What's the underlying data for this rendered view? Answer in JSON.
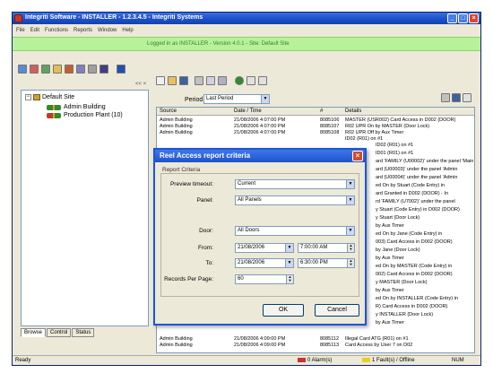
{
  "window": {
    "title": "Integriti Software - INSTALLER - 1.2.3.4.5 - Integriti Systems"
  },
  "menu": [
    "File",
    "Edit",
    "Functions",
    "Reports",
    "Window",
    "Help"
  ],
  "banner": {
    "text": "Logged in as INSTALLER - Version 4.0.1 - Site: Default Site"
  },
  "left_panel": {
    "pane_label": "<< ×",
    "site_name": "Default Site",
    "items": [
      "Admin Building",
      "Production Plant (10)"
    ],
    "tabs": [
      "Browse",
      "Control",
      "Status"
    ]
  },
  "events": {
    "period_label": "Period",
    "period_value": "Last Period",
    "columns": [
      "Source",
      "Date / Time",
      "#",
      "Details"
    ],
    "rows": [
      {
        "source": "Admin Building",
        "datetime": "21/08/2006 4:07:00 PM",
        "num": "8085106",
        "details": "MASTER (USR002) Card Access in D002 (DOOR)"
      },
      {
        "source": "Admin Building",
        "datetime": "21/08/2006 4:07:00 PM",
        "num": "8085107",
        "details": "R02 UPR On by MASTER (Door Lock)"
      },
      {
        "source": "Admin Building",
        "datetime": "21/08/2006 4:07:00 PM",
        "num": "8085108",
        "details": "R02 UPR Off by Aux Timer"
      },
      {
        "source": "",
        "datetime": "",
        "num": "",
        "details": "ID02 (R01) on #1"
      }
    ],
    "details_tail": [
      "ID02 (R01) on #1",
      "ID01 (R01) on #1",
      "ard 'FAMILY (U00002)' under the panel 'Main",
      "ard (U00003)' under the panel 'Admin",
      "ard (U00004)' under the panel 'Admin",
      "ed On by Stuart (Code Entry) in",
      "ard Granted in D002 (DOOR) - In",
      "rd 'FAMILY (U7002)' under the panel",
      "y Stuart (Code Entry) in D002 (DOOR)",
      "y Stuart (Door Lock)",
      "by Aux Timer",
      "ed On by Jane (Code Entry) in",
      "003) Card Access in D002 (DOOR)",
      "by Jane (Door Lock)",
      "by Aux Timer",
      "ed On by MASTER (Code Entry) in",
      "002) Card Access in D002 (DOOR)",
      "y MASTER (Door Lock)",
      "by Aux Timer",
      "ed On by INSTALLER (Code Entry) in",
      "R) Card Access in D002 (DOOR)",
      "y INSTALLER (Door Lock)",
      "by Aux Timer"
    ],
    "bottom_rows": [
      {
        "source": "Admin Building",
        "datetime": "21/08/2006 4:09:00 PM",
        "num": "8085112",
        "details": "Illegal Card ATG (R01) on #1"
      },
      {
        "source": "Admin Building",
        "datetime": "21/08/2006 4:09:00 PM",
        "num": "8085113",
        "details": "Card Access by User 7 on D02"
      }
    ]
  },
  "status_bar": {
    "left": "Ready",
    "alarms": "0 Alarm(s)",
    "faults": "1 Fault(s) / Offline",
    "mode": "NUM"
  },
  "dialog": {
    "title": "Reel Access report criteria",
    "subtitle": "Report Criteria",
    "fields": {
      "preview_label": "Preview timeout:",
      "preview_value": "Current",
      "panel_label": "Panel:",
      "panel_value": "All Panels",
      "door_label": "Door:",
      "door_value": "All Doors",
      "from_label": "From:",
      "from_date": "21/08/2006",
      "from_time": "7:00:00 AM",
      "to_label": "To:",
      "to_date": "21/08/2006",
      "to_time": "6:30:00 PM",
      "records_label": "Records Per Page:",
      "records_value": "60"
    },
    "ok_label": "OK",
    "cancel_label": "Cancel"
  },
  "colors": {
    "title_bar": "#1b4fc8",
    "banner": "#b7f29a",
    "dialog_border": "#1d55d4",
    "close_button": "#d9482b"
  }
}
